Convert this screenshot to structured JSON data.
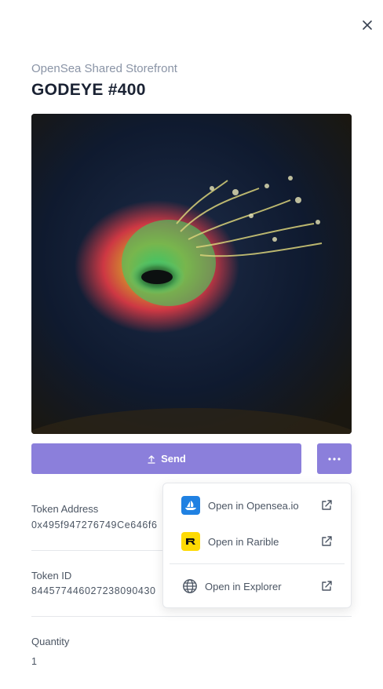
{
  "header": {
    "collection": "OpenSea Shared Storefront",
    "title": "GODEYE #400"
  },
  "actions": {
    "send_label": "Send"
  },
  "details": {
    "token_address_label": "Token Address",
    "token_address_value": "0x495f947276749Ce646f6",
    "token_id_label": "Token ID",
    "token_id_value": "844577446027238090430",
    "quantity_label": "Quantity",
    "quantity_value": "1"
  },
  "menu": {
    "items": [
      {
        "label": "Open in Opensea.io",
        "icon": "opensea-icon"
      },
      {
        "label": "Open in Rarible",
        "icon": "rarible-icon"
      },
      {
        "label": "Open in Explorer",
        "icon": "globe-icon"
      }
    ]
  },
  "colors": {
    "accent": "#8b7fdb",
    "opensea": "#2081e2",
    "rarible": "#feda03"
  }
}
